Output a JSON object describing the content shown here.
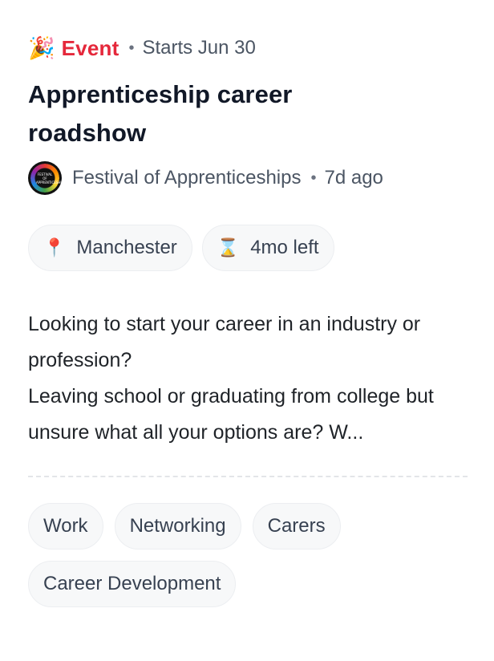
{
  "event": {
    "type_icon": "party-popper-icon",
    "type_label": "Event",
    "separator": "•",
    "starts_text": "Starts Jun 30",
    "title": "Apprenticeship career roadshow",
    "organizer": {
      "avatar_text": "FESTIVAL OF APPRENTICESHIPS",
      "name": "Festival of Apprenticeships",
      "posted_ago": "7d ago"
    },
    "chips": [
      {
        "icon": "📍",
        "icon_name": "location-pin-icon",
        "label": "Manchester"
      },
      {
        "icon": "⌛",
        "icon_name": "hourglass-icon",
        "label": "4mo left"
      }
    ],
    "description_lines": [
      "Looking to start your career in an industry or profession?",
      "Leaving school or graduating from college but unsure what all your options are? W..."
    ],
    "tags": [
      "Work",
      "Networking",
      "Carers",
      "Career Development"
    ]
  },
  "colors": {
    "accent": "#e5283b",
    "chip_bg": "#f7f8f9",
    "muted_text": "#4b5563"
  }
}
